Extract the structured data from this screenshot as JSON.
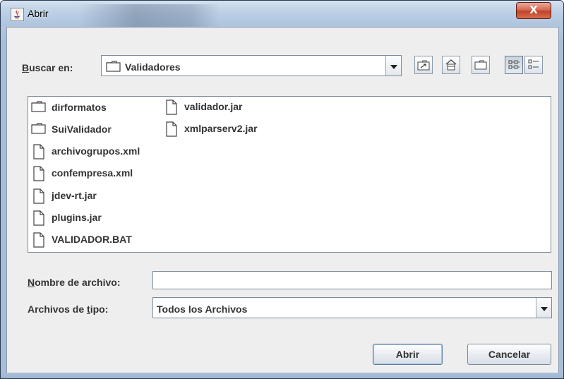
{
  "window": {
    "title": "Abrir",
    "close_glyph": "X"
  },
  "toolbar": {
    "look_in_label_prefix": "B",
    "look_in_label_rest": "uscar en:",
    "look_in_value": "Validadores",
    "buttons": [
      {
        "icon": "up-folder-icon"
      },
      {
        "icon": "home-icon"
      },
      {
        "icon": "new-folder-icon"
      },
      {
        "icon": "list-view-icon"
      },
      {
        "icon": "details-view-icon"
      }
    ]
  },
  "files": {
    "column1": [
      {
        "name": "dirformatos",
        "type": "folder"
      },
      {
        "name": "SuiValidador",
        "type": "folder"
      },
      {
        "name": "archivogrupos.xml",
        "type": "file"
      },
      {
        "name": "confempresa.xml",
        "type": "file"
      },
      {
        "name": "jdev-rt.jar",
        "type": "file"
      },
      {
        "name": "plugins.jar",
        "type": "file"
      },
      {
        "name": "VALIDADOR.BAT",
        "type": "file"
      }
    ],
    "column2": [
      {
        "name": "validador.jar",
        "type": "file"
      },
      {
        "name": "xmlparserv2.jar",
        "type": "file"
      }
    ]
  },
  "filename": {
    "label_prefix": "N",
    "label_rest": "ombre de archivo:",
    "value": ""
  },
  "filetype": {
    "label_prefix": "Archivos de ",
    "label_mnemonic": "t",
    "label_rest": "ipo:",
    "value": "Todos los Archivos"
  },
  "actions": {
    "open_label": "Abrir",
    "cancel_label": "Cancelar"
  }
}
